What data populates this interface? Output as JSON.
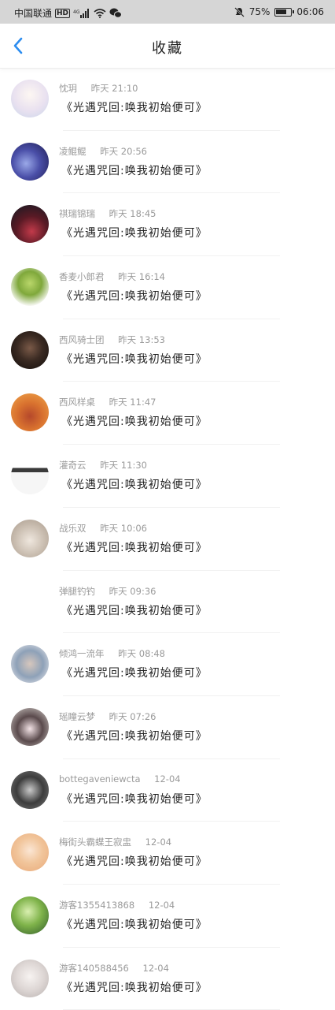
{
  "status_bar": {
    "carrier": "中国联通",
    "hd_badge": "HD",
    "signal_label": "4G",
    "battery_text": "75%",
    "battery_level": 0.75,
    "time": "06:06"
  },
  "header": {
    "title": "收藏",
    "accent_color": "#2c8df0"
  },
  "list": {
    "items": [
      {
        "name": "忱玥",
        "time": "昨天 21:10",
        "message": "《光遇咒回:唤我初始便可》",
        "avatar": "anime-girl-light"
      },
      {
        "name": "凌鲲鲲",
        "time": "昨天 20:56",
        "message": "《光遇咒回:唤我初始便可》",
        "avatar": "whale-night"
      },
      {
        "name": "祺瑞锦瑞",
        "time": "昨天 18:45",
        "message": "《光遇咒回:唤我初始便可》",
        "avatar": "woman-red"
      },
      {
        "name": "香麦小郎君",
        "time": "昨天 16:14",
        "message": "《光遇咒回:唤我初始便可》",
        "avatar": "green-tree"
      },
      {
        "name": "西风骑士团",
        "time": "昨天 13:53",
        "message": "《光遇咒回:唤我初始便可》",
        "avatar": "dark-figure"
      },
      {
        "name": "西风样桌",
        "time": "昨天 11:47",
        "message": "《光遇咒回:唤我初始便可》",
        "avatar": "cartoon-couple"
      },
      {
        "name": "灌奇云",
        "time": "昨天 11:30",
        "message": "《光遇咒回:唤我初始便可》",
        "avatar": "text-sticker"
      },
      {
        "name": "战乐双",
        "time": "昨天 10:06",
        "message": "《光遇咒回:唤我初始便可》",
        "avatar": "seashell"
      },
      {
        "name": "弹腿钓钓",
        "time": "昨天 09:36",
        "message": "《光遇咒回:唤我初始便可》",
        "avatar": "blank"
      },
      {
        "name": "倾鸿一流年",
        "time": "昨天 08:48",
        "message": "《光遇咒回:唤我初始便可》",
        "avatar": "anime-boy"
      },
      {
        "name": "瑶瞳云梦",
        "time": "昨天 07:26",
        "message": "《光遇咒回:唤我初始便可》",
        "avatar": "girl-dark-hair"
      },
      {
        "name": "bottegaveniewcta",
        "time": "12-04",
        "message": "《光遇咒回:唤我初始便可》",
        "avatar": "street-girl"
      },
      {
        "name": "梅街头霸蝶王寂盅",
        "time": "12-04",
        "message": "《光遇咒回:唤我初始便可》",
        "avatar": "orange-hair"
      },
      {
        "name": "游客1355413868",
        "time": "12-04",
        "message": "《光遇咒回:唤我初始便可》",
        "avatar": "green-leaves"
      },
      {
        "name": "游客140588456",
        "time": "12-04",
        "message": "《光遇咒回:唤我初始便可》",
        "avatar": "white-hair-girl"
      }
    ]
  }
}
